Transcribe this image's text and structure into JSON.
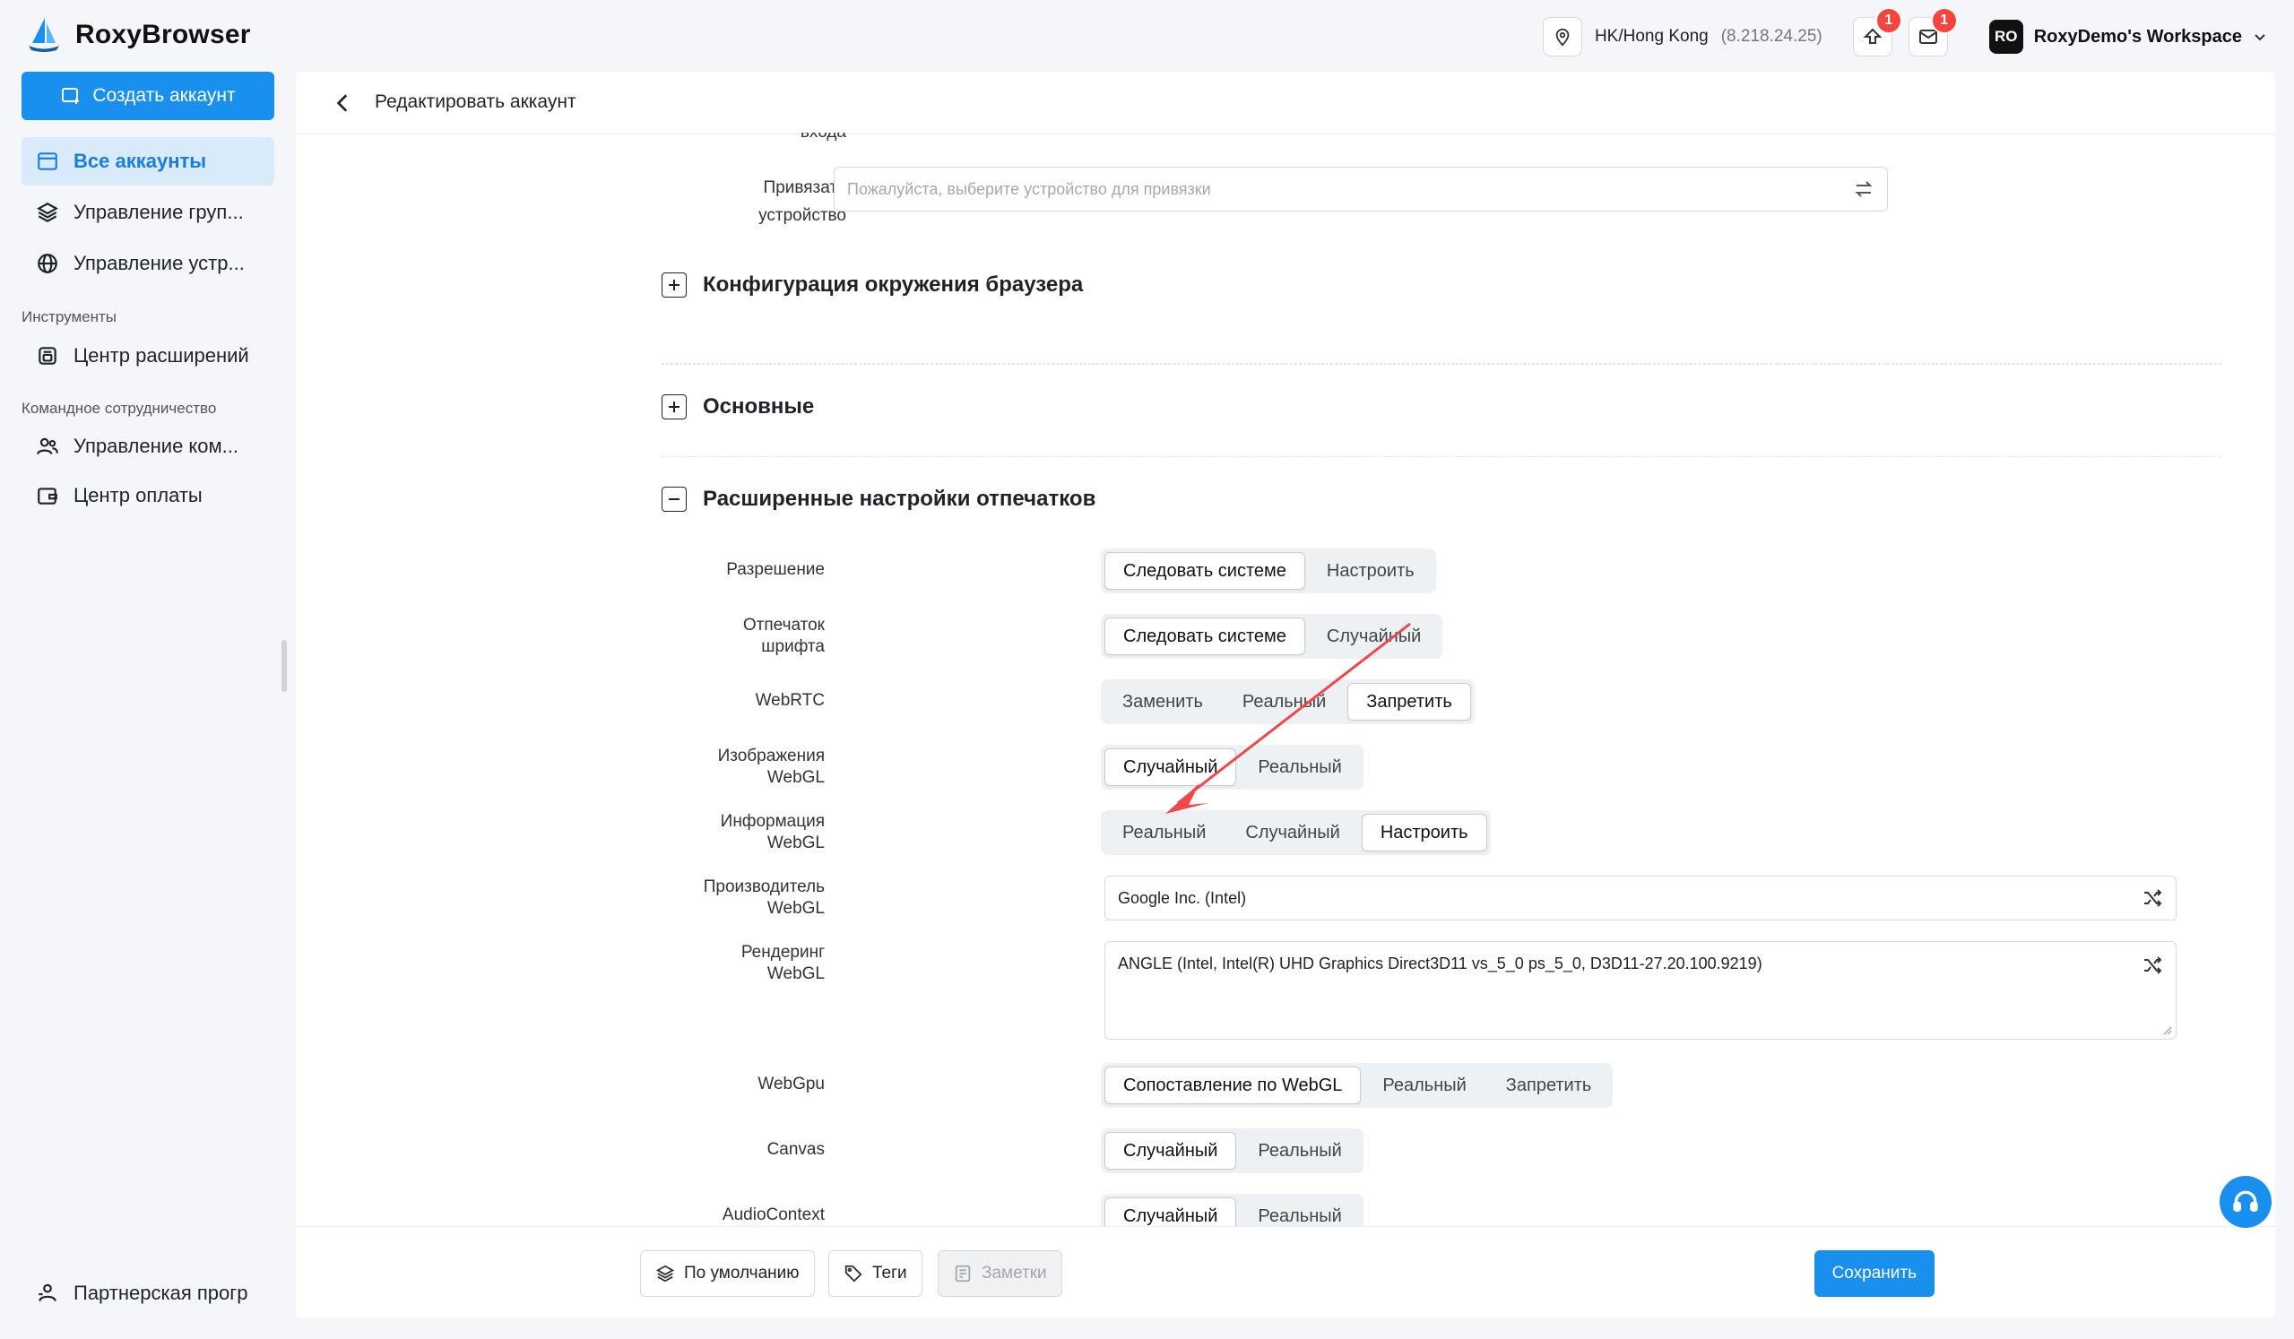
{
  "app": {
    "name": "RoxyBrowser"
  },
  "topbar": {
    "location": "HK/Hong Kong",
    "ip": "(8.218.24.25)",
    "upload_badge": "1",
    "mail_badge": "1",
    "workspace_avatar": "RO",
    "workspace_name": "RoxyDemo's Workspace"
  },
  "sidebar": {
    "create_label": "Создать аккаунт",
    "items": [
      {
        "label": "Все аккаунты",
        "icon": "window-icon"
      },
      {
        "label": "Управление груп...",
        "icon": "layers-icon"
      },
      {
        "label": "Управление устр...",
        "icon": "globe-icon"
      }
    ],
    "section_tools": "Инструменты",
    "tools_items": [
      {
        "label": "Центр расширений",
        "icon": "extension-icon"
      }
    ],
    "section_team": "Командное сотрудничество",
    "team_items": [
      {
        "label": "Управление ком...",
        "icon": "team-icon"
      },
      {
        "label": "Центр оплаты",
        "icon": "wallet-icon"
      }
    ],
    "partner_label": "Партнерская прогр"
  },
  "main": {
    "title": "Редактировать аккаунт",
    "cut_label": "входа",
    "bind_device": {
      "label_1": "Привязать",
      "label_2": "устройство",
      "placeholder": "Пожалуйста, выберите устройство для привязки"
    },
    "sections": [
      {
        "title": "Конфигурация окружения браузера",
        "expanded": false
      },
      {
        "title": "Основные",
        "expanded": false
      },
      {
        "title": "Расширенные настройки отпечатков",
        "expanded": true
      }
    ],
    "fields": {
      "resolution": {
        "label": "Разрешение",
        "options": [
          "Следовать системе",
          "Настроить"
        ],
        "selected": "Следовать системе"
      },
      "font": {
        "label_1": "Отпечаток",
        "label_2": "шрифта",
        "options": [
          "Следовать системе",
          "Случайный"
        ],
        "selected": "Следовать системе"
      },
      "webrtc": {
        "label": "WebRTC",
        "options": [
          "Заменить",
          "Реальный",
          "Запретить"
        ],
        "selected": "Запретить"
      },
      "webgl_images": {
        "label_1": "Изображения",
        "label_2": "WebGL",
        "options": [
          "Случайный",
          "Реальный"
        ],
        "selected": "Случайный"
      },
      "webgl_info": {
        "label_1": "Информация",
        "label_2": "WebGL",
        "options": [
          "Реальный",
          "Случайный",
          "Настроить"
        ],
        "selected": "Настроить"
      },
      "webgl_vendor": {
        "label_1": "Производитель",
        "label_2": "WebGL",
        "value": "Google Inc. (Intel)"
      },
      "webgl_renderer": {
        "label_1": "Рендеринг",
        "label_2": "WebGL",
        "value": "ANGLE (Intel, Intel(R) UHD Graphics Direct3D11 vs_5_0 ps_5_0, D3D11-27.20.100.9219)"
      },
      "webgpu": {
        "label": "WebGpu",
        "options": [
          "Сопоставление по WebGL",
          "Реальный",
          "Запретить"
        ],
        "selected": "Сопоставление по WebGL"
      },
      "canvas": {
        "label": "Canvas",
        "options": [
          "Случайный",
          "Реальный"
        ],
        "selected": "Случайный"
      },
      "audio": {
        "label": "AudioContext",
        "options": [
          "Случайный",
          "Реальный"
        ],
        "selected": "Случайный"
      }
    }
  },
  "footer": {
    "default_label": "По умолчанию",
    "tags_label": "Теги",
    "notes_label": "Заметки",
    "save_label": "Сохранить"
  },
  "colors": {
    "accent": "#1a90ee",
    "badge": "#f5453d",
    "annotation_arrow": "#f0484a"
  }
}
